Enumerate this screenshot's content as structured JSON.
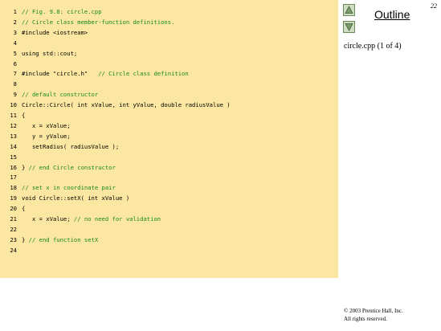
{
  "page_number": "22",
  "outline": {
    "title": "Outline"
  },
  "file_label": "circle.cpp (1 of 4)",
  "copyright": {
    "line1": "© 2003 Prentice Hall, Inc.",
    "line2": "All rights reserved."
  },
  "nav": {
    "up_icon": "triangle-up",
    "down_icon": "triangle-down"
  },
  "colors": {
    "code_background": "#fbe6a2",
    "comment": "#1a8a1a",
    "nav_button": "#cfdcc4"
  },
  "code_lines": [
    {
      "num": "1",
      "parts": [
        {
          "text": "// Fig. 9.8: circle.cpp",
          "type": "comment"
        }
      ]
    },
    {
      "num": "2",
      "parts": [
        {
          "text": "// Circle class member-function definitions.",
          "type": "comment"
        }
      ]
    },
    {
      "num": "3",
      "parts": [
        {
          "text": "#include <iostream>",
          "type": "directive"
        }
      ]
    },
    {
      "num": "4",
      "parts": []
    },
    {
      "num": "5",
      "parts": [
        {
          "text": "using std::cout;",
          "type": "plain"
        }
      ]
    },
    {
      "num": "6",
      "parts": []
    },
    {
      "num": "7",
      "parts": [
        {
          "text": "#include \"circle.h\"   ",
          "type": "directive"
        },
        {
          "text": "// Circle class definition",
          "type": "comment"
        }
      ]
    },
    {
      "num": "8",
      "parts": []
    },
    {
      "num": "9",
      "parts": [
        {
          "text": "// default constructor",
          "type": "comment"
        }
      ]
    },
    {
      "num": "10",
      "parts": [
        {
          "text": "Circle::Circle( int xValue, int yValue, double radiusValue )",
          "type": "plain"
        }
      ]
    },
    {
      "num": "11",
      "parts": [
        {
          "text": "{",
          "type": "plain"
        }
      ]
    },
    {
      "num": "12",
      "parts": [
        {
          "text": "   x = xValue;",
          "type": "plain"
        }
      ]
    },
    {
      "num": "13",
      "parts": [
        {
          "text": "   y = yValue;",
          "type": "plain"
        }
      ]
    },
    {
      "num": "14",
      "parts": [
        {
          "text": "   setRadius( radiusValue );",
          "type": "plain"
        }
      ]
    },
    {
      "num": "15",
      "parts": []
    },
    {
      "num": "16",
      "parts": [
        {
          "text": "} ",
          "type": "plain"
        },
        {
          "text": "// end Circle constructor",
          "type": "comment"
        }
      ]
    },
    {
      "num": "17",
      "parts": []
    },
    {
      "num": "18",
      "parts": [
        {
          "text": "// set x in coordinate pair",
          "type": "comment"
        }
      ]
    },
    {
      "num": "19",
      "parts": [
        {
          "text": "void Circle::setX( int xValue )",
          "type": "plain"
        }
      ]
    },
    {
      "num": "20",
      "parts": [
        {
          "text": "{",
          "type": "plain"
        }
      ]
    },
    {
      "num": "21",
      "parts": [
        {
          "text": "   x = xValue; ",
          "type": "plain"
        },
        {
          "text": "// no need for validation",
          "type": "comment"
        }
      ]
    },
    {
      "num": "22",
      "parts": []
    },
    {
      "num": "23",
      "parts": [
        {
          "text": "} ",
          "type": "plain"
        },
        {
          "text": "// end function setX",
          "type": "comment"
        }
      ]
    },
    {
      "num": "24",
      "parts": []
    }
  ]
}
